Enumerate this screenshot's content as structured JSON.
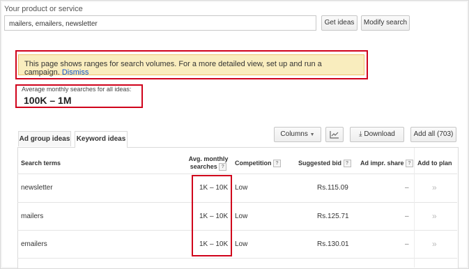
{
  "search": {
    "label": "Your product or service",
    "value": "mailers, emailers, newsletter",
    "get_ideas": "Get ideas",
    "modify_search": "Modify search"
  },
  "notice": {
    "text": "This page shows ranges for search volumes. For a more detailed view, set up and run a campaign.",
    "dismiss": "Dismiss"
  },
  "average": {
    "label": "Average monthly searches for all ideas:",
    "value": "100K – 1M"
  },
  "tabs": [
    {
      "label": "Ad group ideas",
      "active": false
    },
    {
      "label": "Keyword ideas",
      "active": true
    }
  ],
  "toolbar": {
    "columns": "Columns",
    "chart_icon": "line-chart-icon",
    "download": "Download",
    "add_all": "Add all (703)"
  },
  "table": {
    "headers": {
      "term": "Search terms",
      "avg_line1": "Avg. monthly",
      "avg_line2": "searches",
      "competition": "Competition",
      "bid": "Suggested bid",
      "impr": "Ad impr. share",
      "add": "Add to plan"
    },
    "rows": [
      {
        "term": "newsletter",
        "avg": "1K – 10K",
        "competition": "Low",
        "bid": "Rs.115.09",
        "impr": "–",
        "add": "»"
      },
      {
        "term": "mailers",
        "avg": "1K – 10K",
        "competition": "Low",
        "bid": "Rs.125.71",
        "impr": "–",
        "add": "»"
      },
      {
        "term": "emailers",
        "avg": "1K – 10K",
        "competition": "Low",
        "bid": "Rs.130.01",
        "impr": "–",
        "add": "»"
      }
    ]
  },
  "colors": {
    "highlight": "#d0021b",
    "notice_bg": "#f9edbe",
    "link": "#1155cc"
  }
}
